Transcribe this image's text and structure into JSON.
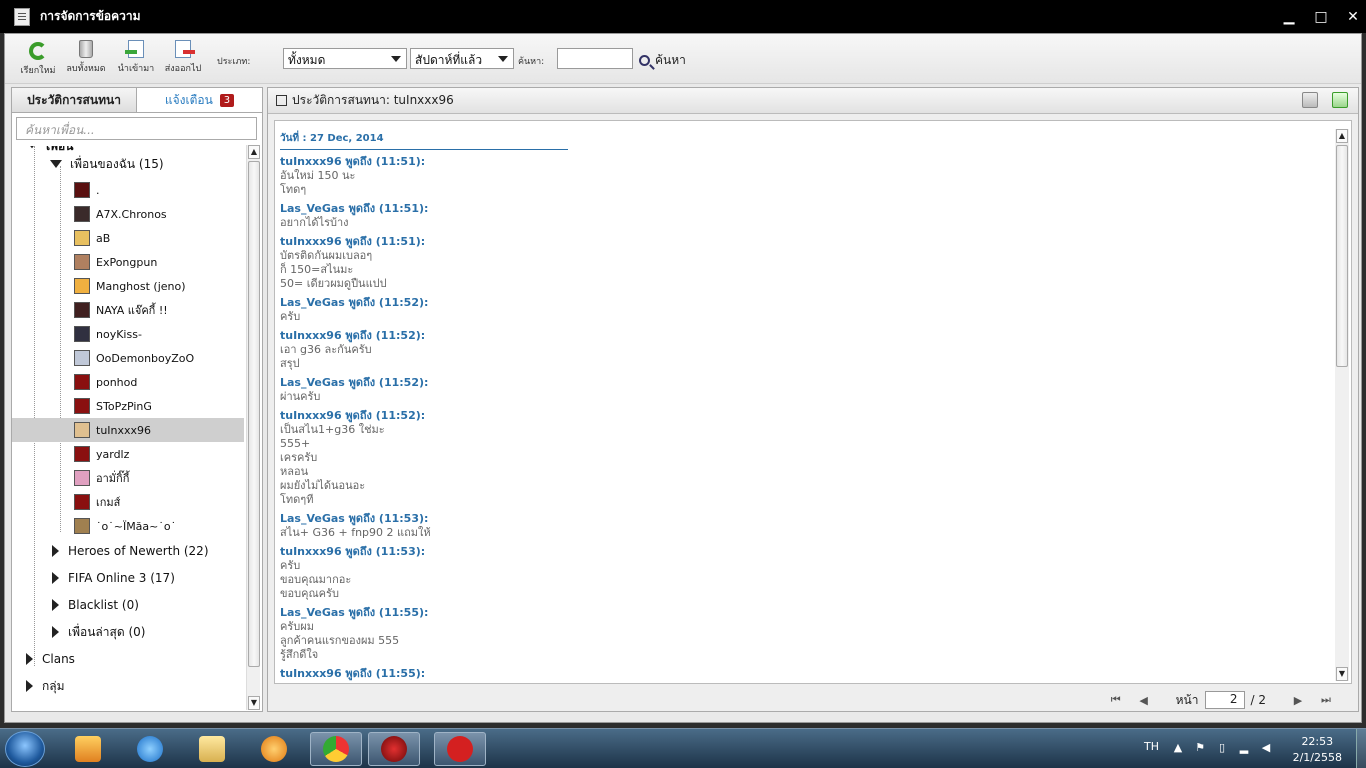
{
  "window": {
    "title": "การจัดการข้อความ"
  },
  "toolbar": {
    "refresh": "เรียกใหม่",
    "delete_all": "ลบทั้งหมด",
    "import": "นำเข้ามา",
    "export": "ส่งออกไป",
    "type_label": "ประเภท:",
    "type_value": "ทั้งหมด",
    "period_value": "สัปดาห์ที่แล้ว",
    "search_label": "ค้นหา:",
    "search_value": "",
    "search_button": "ค้นหา"
  },
  "left": {
    "tab_history": "ประวัติการสนทนา",
    "tab_alerts": "แจ้งเตือน",
    "alert_count": "3",
    "search_placeholder": "ค้นหาเพื่อน...",
    "top_cut": "เพื่อน",
    "group_my_friends": "เพื่อนของฉัน (15)",
    "friends": [
      ".",
      "A7X.Chronos",
      "aB",
      "ExPongpun",
      "Manghost (jeno)",
      "NAYA แจ๊คกี้ !!",
      "noyKiss-",
      "OoDemonboyZoO",
      "ponhod",
      "SToPzPinG",
      "tuInxxx96",
      "yardlz",
      "อามั่กิ๊กี้",
      "เกมส์",
      "˙o˙~ΪΜăa~˙o˙"
    ],
    "groups": [
      "Heroes of Newerth (22)",
      "FIFA Online 3 (17)",
      "Blacklist (0)",
      "เพื่อนล่าสุด (0)"
    ],
    "top_groups": [
      "Clans",
      "กลุ่ม"
    ]
  },
  "right": {
    "header": "ประวัติการสนทนา: tuInxxx96",
    "date": "วันที่ : 27 Dec, 2014",
    "messages": [
      {
        "sender": "tuInxxx96 พูดถึง  (11:51):",
        "lines": [
          "อันใหม่ 150 นะ",
          "โทดๆ"
        ]
      },
      {
        "sender": "Las_VeGas พูดถึง  (11:51):",
        "lines": [
          "อยากได้ไรบ้าง"
        ]
      },
      {
        "sender": "tuInxxx96 พูดถึง  (11:51):",
        "lines": [
          "บัตรติดกันผมเบลอๆ",
          "ก็ 150=สไนมะ",
          "50= เดียวผมดูปืนแปป"
        ]
      },
      {
        "sender": "Las_VeGas พูดถึง  (11:52):",
        "lines": [
          "ครับ"
        ]
      },
      {
        "sender": "tuInxxx96 พูดถึง  (11:52):",
        "lines": [
          "เอา g36 ละกันครับ",
          "สรุป"
        ]
      },
      {
        "sender": "Las_VeGas พูดถึง  (11:52):",
        "lines": [
          "ผ่านครับ"
        ]
      },
      {
        "sender": "tuInxxx96 พูดถึง  (11:52):",
        "lines": [
          "เป็นสไน1+g36 ใช่มะ",
          "555+",
          "เครครับ",
          "หลอน",
          "ผมยังไม่ได้นอนอะ",
          "โทดๆที"
        ]
      },
      {
        "sender": "Las_VeGas พูดถึง  (11:53):",
        "lines": [
          "สไน+ G36 + fnp90 2 แถมให้"
        ]
      },
      {
        "sender": "tuInxxx96 พูดถึง  (11:53):",
        "lines": [
          "ครับ",
          "ขอบคุณมากอะ",
          "ขอบคุณครับ"
        ]
      },
      {
        "sender": "Las_VeGas พูดถึง  (11:55):",
        "lines": [
          "ครับผม",
          "ลูกค้าคนแรกของผม 555",
          "รู้สึกดีใจ"
        ]
      },
      {
        "sender": "tuInxxx96 พูดถึง  (11:55):",
        "lines": []
      }
    ],
    "pager": {
      "label": "หน้า",
      "current": "2",
      "total": "/ 2"
    }
  },
  "taskbar": {
    "lang": "TH",
    "time": "22:53",
    "date": "2/1/2558"
  },
  "colors": {
    "accent": "#2a6fa8",
    "badge": "#b01b1b",
    "titlebar": "#000000"
  }
}
